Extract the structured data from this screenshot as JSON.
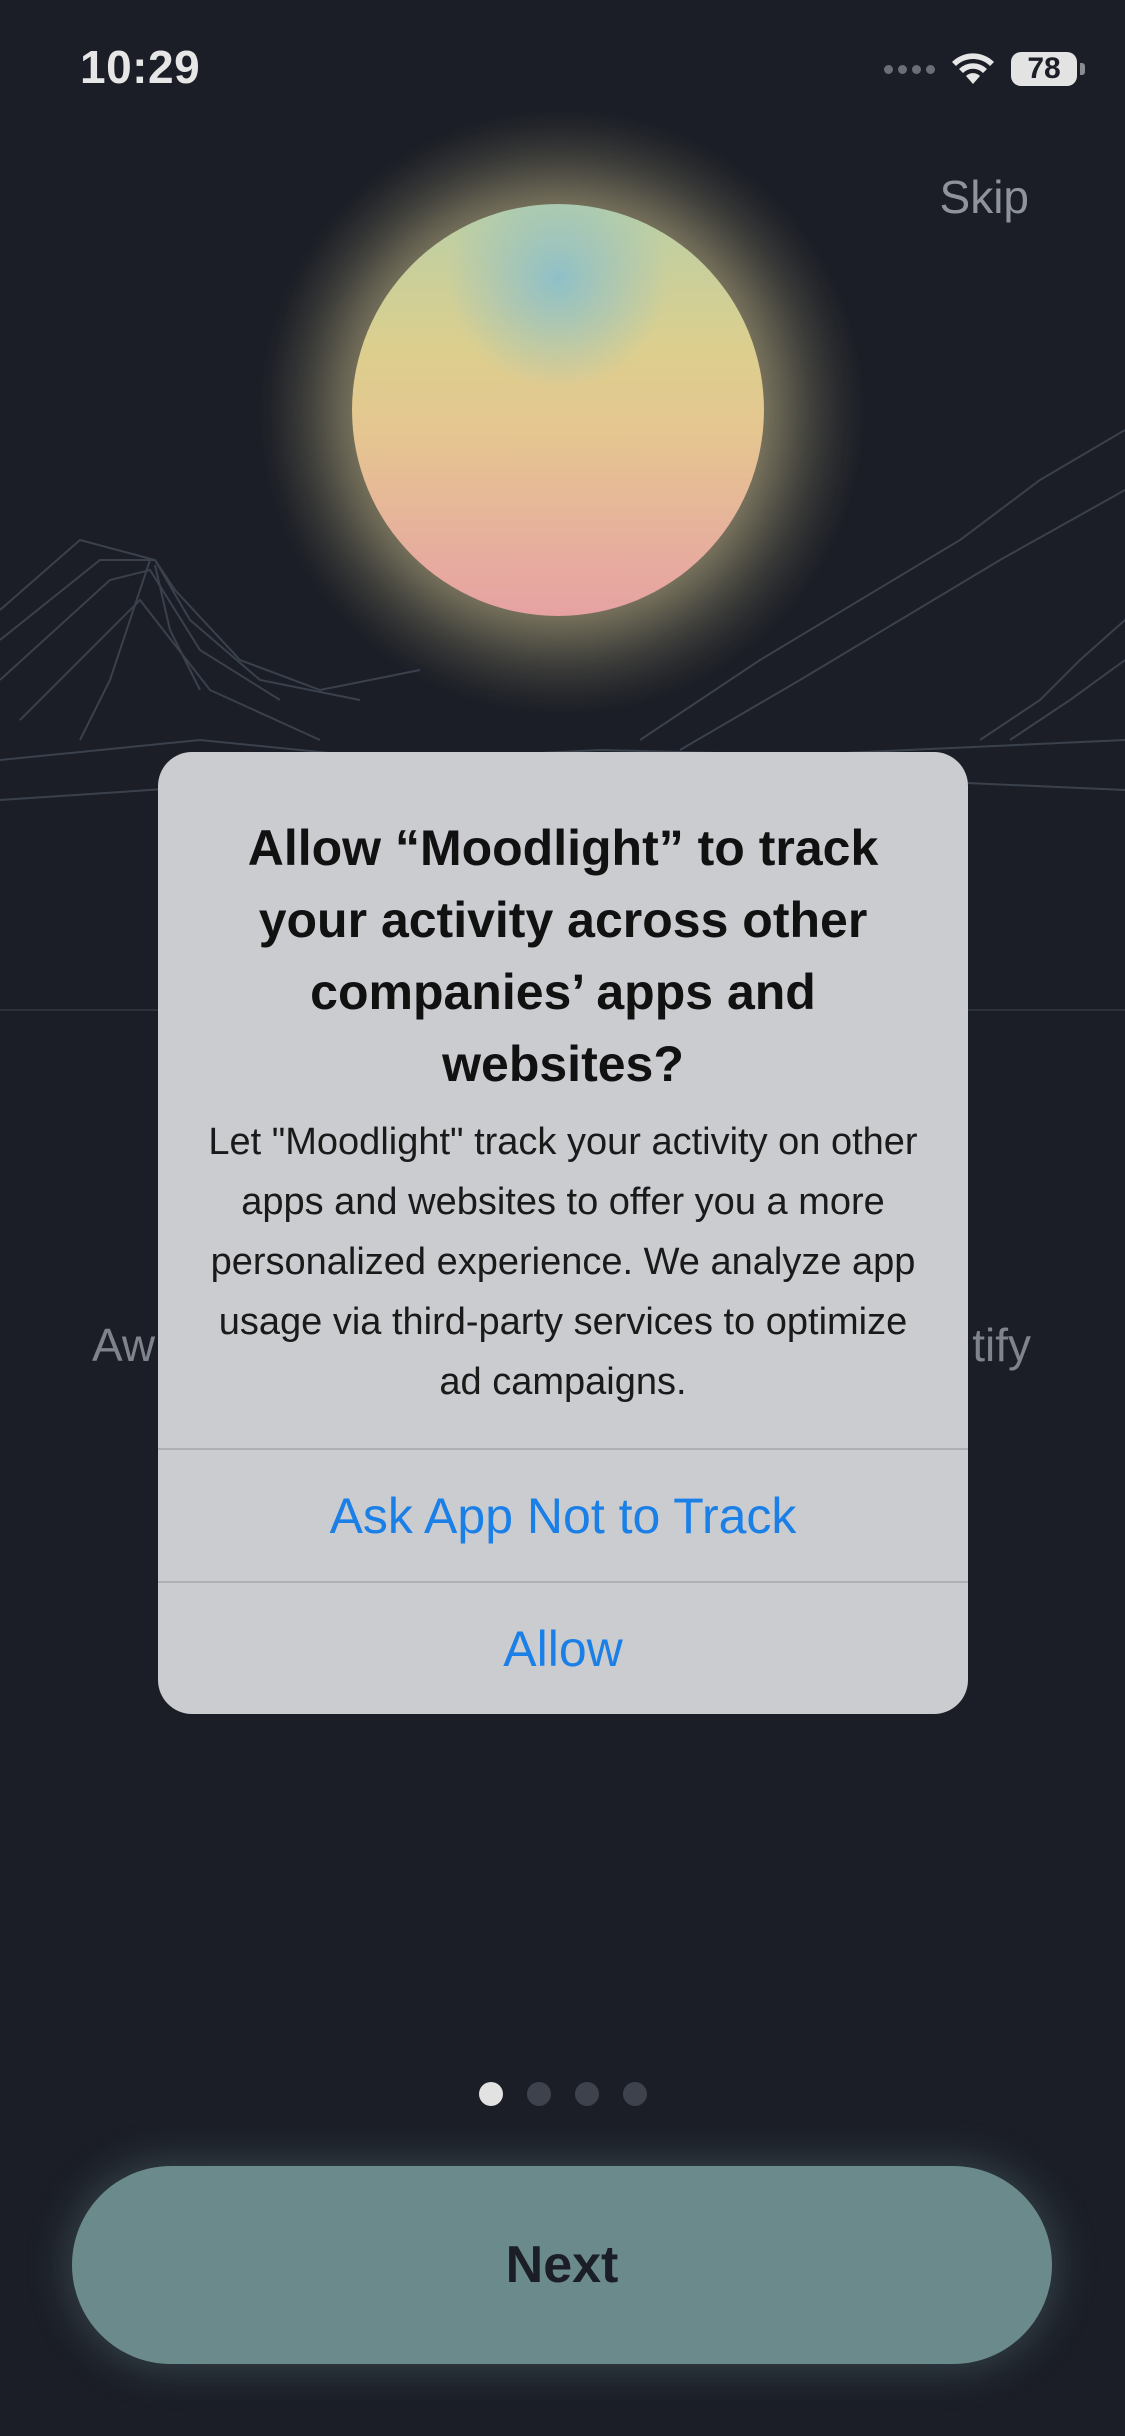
{
  "status_bar": {
    "time": "10:29",
    "battery": "78"
  },
  "onboarding": {
    "skip_label": "Skip",
    "side_text_left": "Aw",
    "side_text_right": "tify",
    "next_label": "Next",
    "page_count": 4,
    "current_page": 1
  },
  "alert": {
    "title": "Allow “Moodlight” to track your activity across other companies’ apps and websites?",
    "message": "Let \"Moodlight\" track your activity on other apps and websites to offer you a more personalized experience. We analyze app usage via third-party services to optimize ad campaigns.",
    "button_deny": "Ask App Not to Track",
    "button_allow": "Allow"
  },
  "colors": {
    "background": "#1b1e26",
    "accent_button": "#6a8a8b",
    "alert_button_text": "#1a7fe6",
    "alert_background": "#cbcccf"
  },
  "icons": [
    "wifi-icon",
    "battery-icon",
    "cellular-signal-icon"
  ]
}
